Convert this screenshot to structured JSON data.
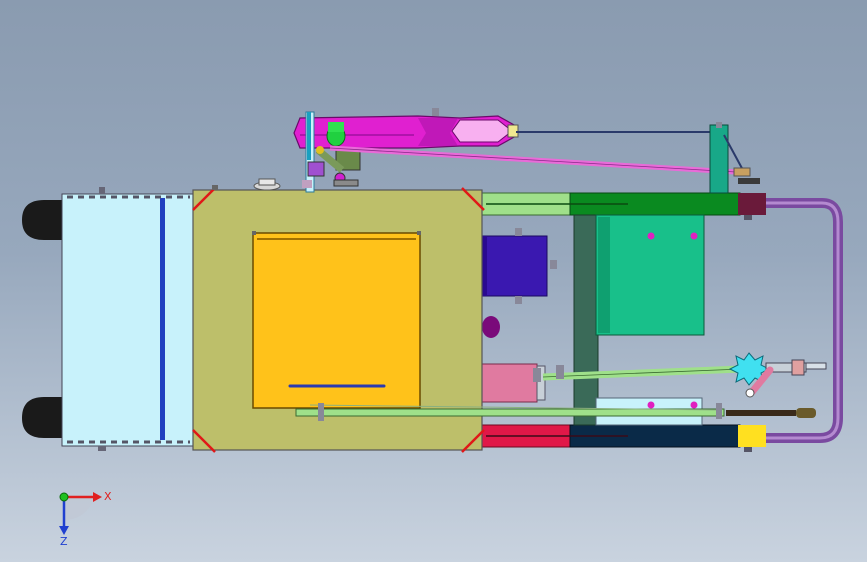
{
  "viewport": {
    "background_top": "#8a9bb0",
    "background_bottom": "#c9d3df"
  },
  "triad": {
    "x_label": "X",
    "z_label": "Z",
    "x_color": "#e02020",
    "y_color": "#20c020",
    "z_color": "#2040d0"
  },
  "parts": {
    "frame_color": "#bdbf6a",
    "panel_color": "#ffc21a",
    "bin_color": "#c8f2fb",
    "wheel_color": "#1a1a1a",
    "motor_color": "#3a18b0",
    "box_color": "#18c08a",
    "arm_color": "#e020d0",
    "link_color": "#e86bd8",
    "handle_color": "#7a4aa0",
    "rail_green": "#0a8a20",
    "rail_red": "#e01848",
    "rail_navy": "#0a2a48",
    "cylinder_color": "#e07aa0",
    "column_color": "#3a6a58"
  }
}
